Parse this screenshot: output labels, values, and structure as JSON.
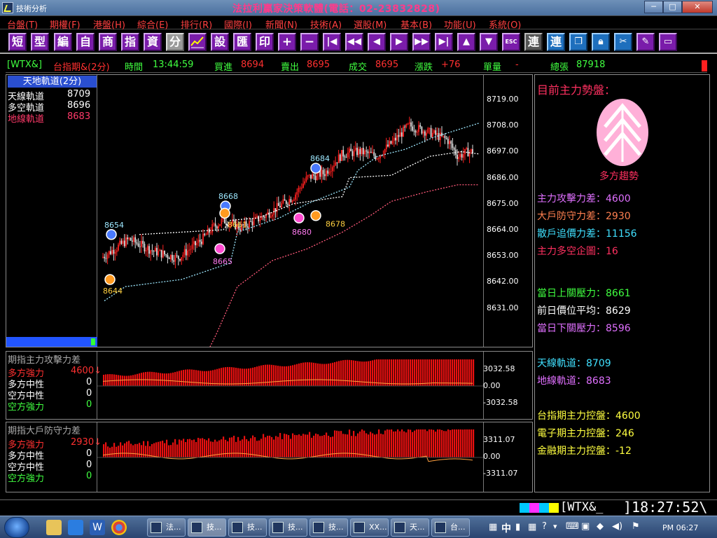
{
  "titlebar": {
    "app_name": "技術分析",
    "title": "法拉利贏家決策軟體(電話：02-23832828)",
    "min": "─",
    "max": "□",
    "close": "✕"
  },
  "menu": [
    "台盤(T)",
    "期權(F)",
    "港盤(H)",
    "綜合(E)",
    "排行(R)",
    "國際(I)",
    "新聞(N)",
    "技術(A)",
    "選股(M)",
    "基本(B)",
    "功能(U)",
    "系統(O)"
  ],
  "toolbar": {
    "chars": [
      "短",
      "型",
      "編",
      "自",
      "商",
      "指",
      "資",
      "分"
    ],
    "chars2": [
      "設",
      "匯",
      "印"
    ],
    "esc": "ESC",
    "lian": "連",
    "lian2": "連"
  },
  "quote": {
    "symbol": "[WTX&]",
    "name": "台指期&(2分)",
    "time_label": "時間",
    "time": "13:44:59",
    "bid_label": "買進",
    "bid": "8694",
    "ask_label": "賣出",
    "ask": "8695",
    "deal_label": "成交",
    "deal": "8695",
    "change_label": "漲跌",
    "change": "+76",
    "vol_label": "單量",
    "vol": "-",
    "total_label": "總張",
    "total": "87918"
  },
  "price_panel": {
    "header": "天地軌道(2分)",
    "legend": [
      {
        "label": "天線軌道",
        "value": "8709",
        "color": "#ffffff"
      },
      {
        "label": "多空軌道",
        "value": "8696",
        "color": "#ffffff"
      },
      {
        "label": "地線軌道",
        "value": "8683",
        "color": "#ff3a6a"
      }
    ],
    "ticks": [
      "8719.00",
      "8708.00",
      "8697.00",
      "8686.00",
      "8675.00",
      "8664.00",
      "8653.00",
      "8642.00",
      "8631.00"
    ],
    "markers": [
      {
        "label": "8654",
        "color": "#9ee8ff"
      },
      {
        "label": "8644",
        "color": "#ffd040"
      },
      {
        "label": "8668",
        "color": "#9ee8ff"
      },
      {
        "label": "8661",
        "color": "#ffd040"
      },
      {
        "label": "8665",
        "color": "#ff7af0"
      },
      {
        "label": "8684",
        "color": "#9ee8ff"
      },
      {
        "label": "8678",
        "color": "#ffd040"
      },
      {
        "label": "8680",
        "color": "#ff7af0"
      }
    ]
  },
  "attack_panel": {
    "title": "期指主力攻擊力差",
    "legend": [
      {
        "label": "多方強力",
        "value": "4600↓",
        "color": "#ff3030"
      },
      {
        "label": "多方中性",
        "value": "0",
        "color": "#ffffff"
      },
      {
        "label": "空方中性",
        "value": "0",
        "color": "#ffffff"
      },
      {
        "label": "空方強力",
        "value": "0",
        "color": "#40ff40"
      }
    ],
    "ticks": [
      "3032.58",
      "0.00",
      "-3032.58"
    ]
  },
  "defense_panel": {
    "title": "期指大戶防守力差",
    "legend": [
      {
        "label": "多方強力",
        "value": "2930↓",
        "color": "#ff3030"
      },
      {
        "label": "多方中性",
        "value": "0",
        "color": "#ffffff"
      },
      {
        "label": "空方中性",
        "value": "0",
        "color": "#ffffff"
      },
      {
        "label": "空方強力",
        "value": "0",
        "color": "#40ff40"
      }
    ],
    "ticks": [
      "3311.07",
      "0.00",
      "-3311.07"
    ]
  },
  "info": {
    "heading": "目前主力勢盤：",
    "trend": "多方趨勢",
    "lines": [
      {
        "label": "主力攻擊力差",
        "value": "4600",
        "color": "#e070ff"
      },
      {
        "label": "大戶防守力差",
        "value": "2930",
        "color": "#ff8050"
      },
      {
        "label": "散戶追價力差",
        "value": "11156",
        "color": "#40e0ff"
      },
      {
        "label": "主力多空企圖",
        "value": "16",
        "color": "#ff3060"
      },
      {
        "label": "當日上關壓力",
        "value": "8661",
        "color": "#40ff40"
      },
      {
        "label": "前日價位平均",
        "value": "8629",
        "color": "#ffffff"
      },
      {
        "label": "當日下關壓力",
        "value": "8596",
        "color": "#e070ff"
      },
      {
        "label": "天線軌道",
        "value": "8709",
        "color": "#40e0ff"
      },
      {
        "label": "地線軌道",
        "value": "8683",
        "color": "#e070ff"
      },
      {
        "label": "台指期主力控盤",
        "value": "4600",
        "color": "#ffff40"
      },
      {
        "label": "電子期主力控盤",
        "value": "246",
        "color": "#ffff40"
      },
      {
        "label": "金融期主力控盤",
        "value": "-12",
        "color": "#ffff40"
      }
    ]
  },
  "status": {
    "symbol": "[WTX&_",
    "clock": "]18:27:52\\"
  },
  "taskbar": {
    "tasks": [
      "法...",
      "技...",
      "技...",
      "技...",
      "技...",
      "XX...",
      "天...",
      "台..."
    ],
    "ime": "中",
    "time": "PM 06:27"
  },
  "chart_data": [
    {
      "type": "candlestick",
      "title": "天地軌道(2分)",
      "ylim": [
        8625,
        8725
      ],
      "ticks": [
        8719,
        8708,
        8697,
        8686,
        8675,
        8664,
        8653,
        8642,
        8631
      ],
      "series": [
        {
          "name": "天線軌道",
          "last": 8709
        },
        {
          "name": "多空軌道",
          "last": 8696
        },
        {
          "name": "地線軌道",
          "last": 8683
        }
      ],
      "annotations": [
        8654,
        8644,
        8668,
        8661,
        8665,
        8684,
        8678,
        8680
      ]
    },
    {
      "type": "bar",
      "title": "期指主力攻擊力差",
      "ylim": [
        -3032.58,
        3032.58
      ],
      "last": 4600
    },
    {
      "type": "bar",
      "title": "期指大戶防守力差",
      "ylim": [
        -3311.07,
        3311.07
      ],
      "last": 2930
    }
  ]
}
